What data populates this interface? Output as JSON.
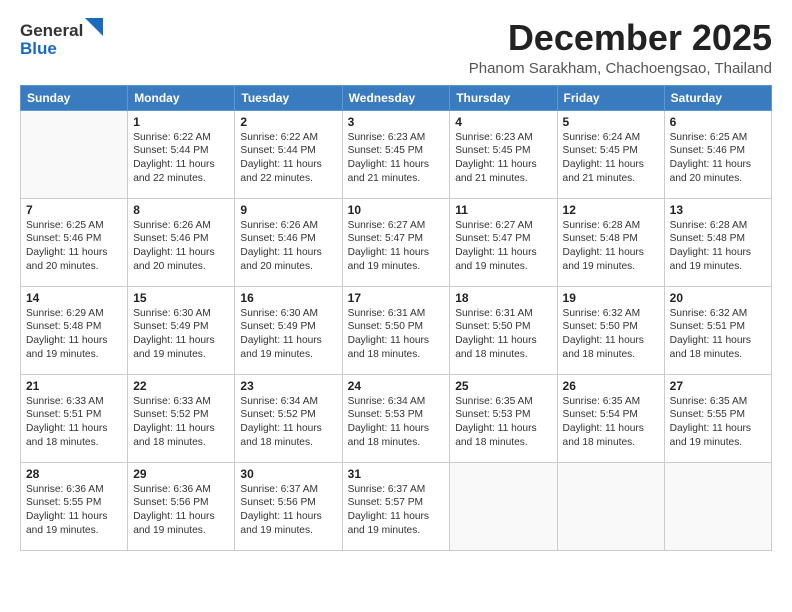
{
  "header": {
    "logo": {
      "general": "General",
      "blue": "Blue"
    },
    "title": "December 2025",
    "subtitle": "Phanom Sarakham, Chachoengsao, Thailand"
  },
  "days_of_week": [
    "Sunday",
    "Monday",
    "Tuesday",
    "Wednesday",
    "Thursday",
    "Friday",
    "Saturday"
  ],
  "weeks": [
    [
      {
        "day": "",
        "info": ""
      },
      {
        "day": "1",
        "info": "Sunrise: 6:22 AM\nSunset: 5:44 PM\nDaylight: 11 hours\nand 22 minutes."
      },
      {
        "day": "2",
        "info": "Sunrise: 6:22 AM\nSunset: 5:44 PM\nDaylight: 11 hours\nand 22 minutes."
      },
      {
        "day": "3",
        "info": "Sunrise: 6:23 AM\nSunset: 5:45 PM\nDaylight: 11 hours\nand 21 minutes."
      },
      {
        "day": "4",
        "info": "Sunrise: 6:23 AM\nSunset: 5:45 PM\nDaylight: 11 hours\nand 21 minutes."
      },
      {
        "day": "5",
        "info": "Sunrise: 6:24 AM\nSunset: 5:45 PM\nDaylight: 11 hours\nand 21 minutes."
      },
      {
        "day": "6",
        "info": "Sunrise: 6:25 AM\nSunset: 5:46 PM\nDaylight: 11 hours\nand 20 minutes."
      }
    ],
    [
      {
        "day": "7",
        "info": "Sunrise: 6:25 AM\nSunset: 5:46 PM\nDaylight: 11 hours\nand 20 minutes."
      },
      {
        "day": "8",
        "info": "Sunrise: 6:26 AM\nSunset: 5:46 PM\nDaylight: 11 hours\nand 20 minutes."
      },
      {
        "day": "9",
        "info": "Sunrise: 6:26 AM\nSunset: 5:46 PM\nDaylight: 11 hours\nand 20 minutes."
      },
      {
        "day": "10",
        "info": "Sunrise: 6:27 AM\nSunset: 5:47 PM\nDaylight: 11 hours\nand 19 minutes."
      },
      {
        "day": "11",
        "info": "Sunrise: 6:27 AM\nSunset: 5:47 PM\nDaylight: 11 hours\nand 19 minutes."
      },
      {
        "day": "12",
        "info": "Sunrise: 6:28 AM\nSunset: 5:48 PM\nDaylight: 11 hours\nand 19 minutes."
      },
      {
        "day": "13",
        "info": "Sunrise: 6:28 AM\nSunset: 5:48 PM\nDaylight: 11 hours\nand 19 minutes."
      }
    ],
    [
      {
        "day": "14",
        "info": "Sunrise: 6:29 AM\nSunset: 5:48 PM\nDaylight: 11 hours\nand 19 minutes."
      },
      {
        "day": "15",
        "info": "Sunrise: 6:30 AM\nSunset: 5:49 PM\nDaylight: 11 hours\nand 19 minutes."
      },
      {
        "day": "16",
        "info": "Sunrise: 6:30 AM\nSunset: 5:49 PM\nDaylight: 11 hours\nand 19 minutes."
      },
      {
        "day": "17",
        "info": "Sunrise: 6:31 AM\nSunset: 5:50 PM\nDaylight: 11 hours\nand 18 minutes."
      },
      {
        "day": "18",
        "info": "Sunrise: 6:31 AM\nSunset: 5:50 PM\nDaylight: 11 hours\nand 18 minutes."
      },
      {
        "day": "19",
        "info": "Sunrise: 6:32 AM\nSunset: 5:50 PM\nDaylight: 11 hours\nand 18 minutes."
      },
      {
        "day": "20",
        "info": "Sunrise: 6:32 AM\nSunset: 5:51 PM\nDaylight: 11 hours\nand 18 minutes."
      }
    ],
    [
      {
        "day": "21",
        "info": "Sunrise: 6:33 AM\nSunset: 5:51 PM\nDaylight: 11 hours\nand 18 minutes."
      },
      {
        "day": "22",
        "info": "Sunrise: 6:33 AM\nSunset: 5:52 PM\nDaylight: 11 hours\nand 18 minutes."
      },
      {
        "day": "23",
        "info": "Sunrise: 6:34 AM\nSunset: 5:52 PM\nDaylight: 11 hours\nand 18 minutes."
      },
      {
        "day": "24",
        "info": "Sunrise: 6:34 AM\nSunset: 5:53 PM\nDaylight: 11 hours\nand 18 minutes."
      },
      {
        "day": "25",
        "info": "Sunrise: 6:35 AM\nSunset: 5:53 PM\nDaylight: 11 hours\nand 18 minutes."
      },
      {
        "day": "26",
        "info": "Sunrise: 6:35 AM\nSunset: 5:54 PM\nDaylight: 11 hours\nand 18 minutes."
      },
      {
        "day": "27",
        "info": "Sunrise: 6:35 AM\nSunset: 5:55 PM\nDaylight: 11 hours\nand 19 minutes."
      }
    ],
    [
      {
        "day": "28",
        "info": "Sunrise: 6:36 AM\nSunset: 5:55 PM\nDaylight: 11 hours\nand 19 minutes."
      },
      {
        "day": "29",
        "info": "Sunrise: 6:36 AM\nSunset: 5:56 PM\nDaylight: 11 hours\nand 19 minutes."
      },
      {
        "day": "30",
        "info": "Sunrise: 6:37 AM\nSunset: 5:56 PM\nDaylight: 11 hours\nand 19 minutes."
      },
      {
        "day": "31",
        "info": "Sunrise: 6:37 AM\nSunset: 5:57 PM\nDaylight: 11 hours\nand 19 minutes."
      },
      {
        "day": "",
        "info": ""
      },
      {
        "day": "",
        "info": ""
      },
      {
        "day": "",
        "info": ""
      }
    ]
  ]
}
